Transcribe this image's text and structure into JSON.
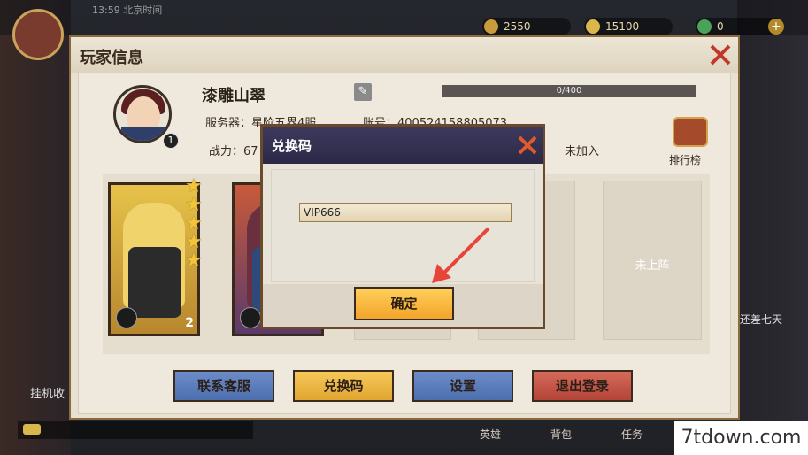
{
  "top": {
    "time": "13:59 北京时间",
    "res1": "2550",
    "res2": "15100",
    "res3": "0",
    "plus": "+"
  },
  "panel": {
    "title": "玩家信息"
  },
  "player": {
    "name": "漆雕山翠",
    "level": "1",
    "exp": "0/400",
    "server_label": "服务器：",
    "server_value": "星阶五界4服",
    "account_label": "账号：",
    "account_value": "400524158805073",
    "power_label": "战力：",
    "power_value": "67",
    "guild_value": "未加入",
    "rank_label": "排行榜"
  },
  "cards": [
    {
      "count": "2"
    },
    {
      "count": ""
    }
  ],
  "slot_empty": "未上阵",
  "buttons": {
    "contact": "联系客服",
    "redeem": "兑换码",
    "settings": "设置",
    "logout": "退出登录"
  },
  "dialog": {
    "title": "兑换码",
    "code_value": "VIP666",
    "confirm": "确定"
  },
  "side": {
    "left": "挂机收",
    "right": "还差七天"
  },
  "nav": {
    "hero": "英雄",
    "bag": "背包",
    "task": "任务"
  },
  "watermark": "7tdown.com",
  "colors": {
    "accent": "#e2a531",
    "dialog_head": "#2b2846",
    "panel_border": "#8b6a3e"
  }
}
